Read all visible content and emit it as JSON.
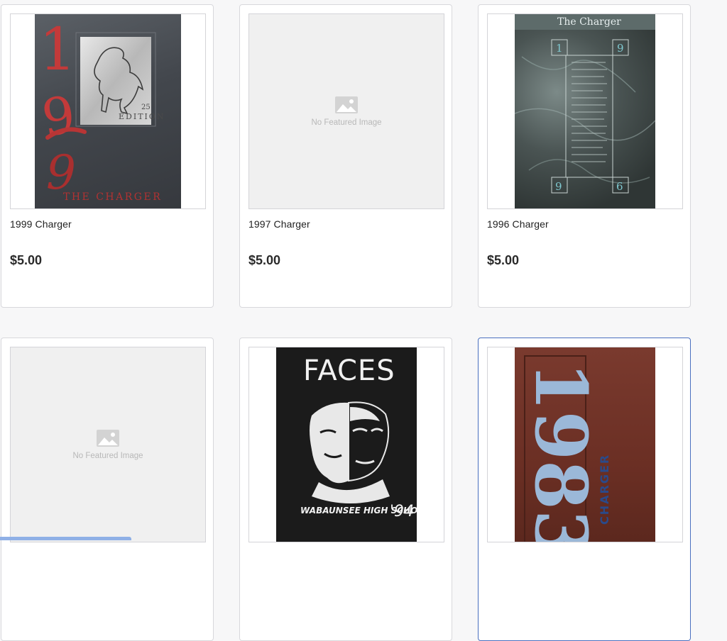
{
  "products": [
    {
      "title": "1999 Charger",
      "price": "$5.00",
      "cover_lettering": [
        "1",
        "9",
        "9",
        "THE CHARGER",
        "25",
        "EDITION"
      ]
    },
    {
      "title": "1997 Charger",
      "price": "$5.00",
      "placeholder": "No Featured Image"
    },
    {
      "title": "1996 Charger",
      "price": "$5.00",
      "cover_lettering": [
        "The Charger",
        "1",
        "9",
        "9",
        "6"
      ]
    },
    {
      "placeholder": "No Featured Image"
    },
    {
      "cover_lettering": [
        "FACES",
        "WABAUNSEE HIGH SCHOOL",
        "'94"
      ]
    },
    {
      "cover_lettering": [
        "1983",
        "CHARGER"
      ]
    }
  ],
  "colors": {
    "card_border": "#d8d8dc",
    "selected_border": "#4a6fbf",
    "scrollbar": "#8fb0e6",
    "placeholder_bg": "#f0f0f0"
  },
  "icons": [
    "image-placeholder-icon"
  ]
}
